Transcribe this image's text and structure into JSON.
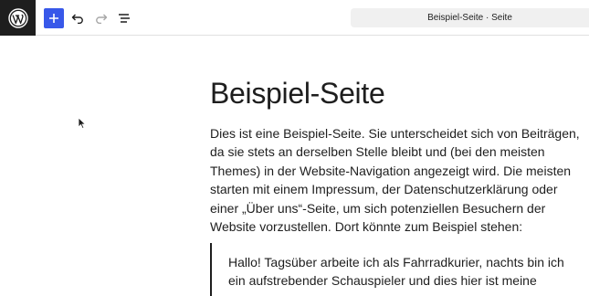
{
  "toolbar": {
    "logo": "wordpress-icon",
    "add_block": "plus-icon",
    "undo": "undo-icon",
    "redo": "redo-icon",
    "document_overview": "list-view-icon",
    "document_title": "Beispiel-Seite · Seite"
  },
  "page": {
    "title": "Beispiel-Seite",
    "paragraph_lines": [
      "Dies ist eine Beispiel-Seite. Sie unterscheidet sich von Beiträgen,",
      "da sie stets an derselben Stelle bleibt und (bei den meisten",
      "Themes) in der Website-Navigation angezeigt wird. Die meisten",
      "starten mit einem Impressum, der Datenschutzerklärung oder",
      "einer „Über uns“-Seite, um sich potenziellen Besuchern der",
      "Website vorzustellen. Dort könnte zum Beispiel stehen:"
    ],
    "quote_lines": [
      "Hallo! Tagsüber arbeite ich als Fahrradkurier, nachts bin ich",
      "ein aufstrebender Schauspieler und dies hier ist meine"
    ]
  },
  "colors": {
    "accent": "#3858e9",
    "logo_bg": "#1e1e1e",
    "title_bar_bg": "#f0f0f0"
  }
}
